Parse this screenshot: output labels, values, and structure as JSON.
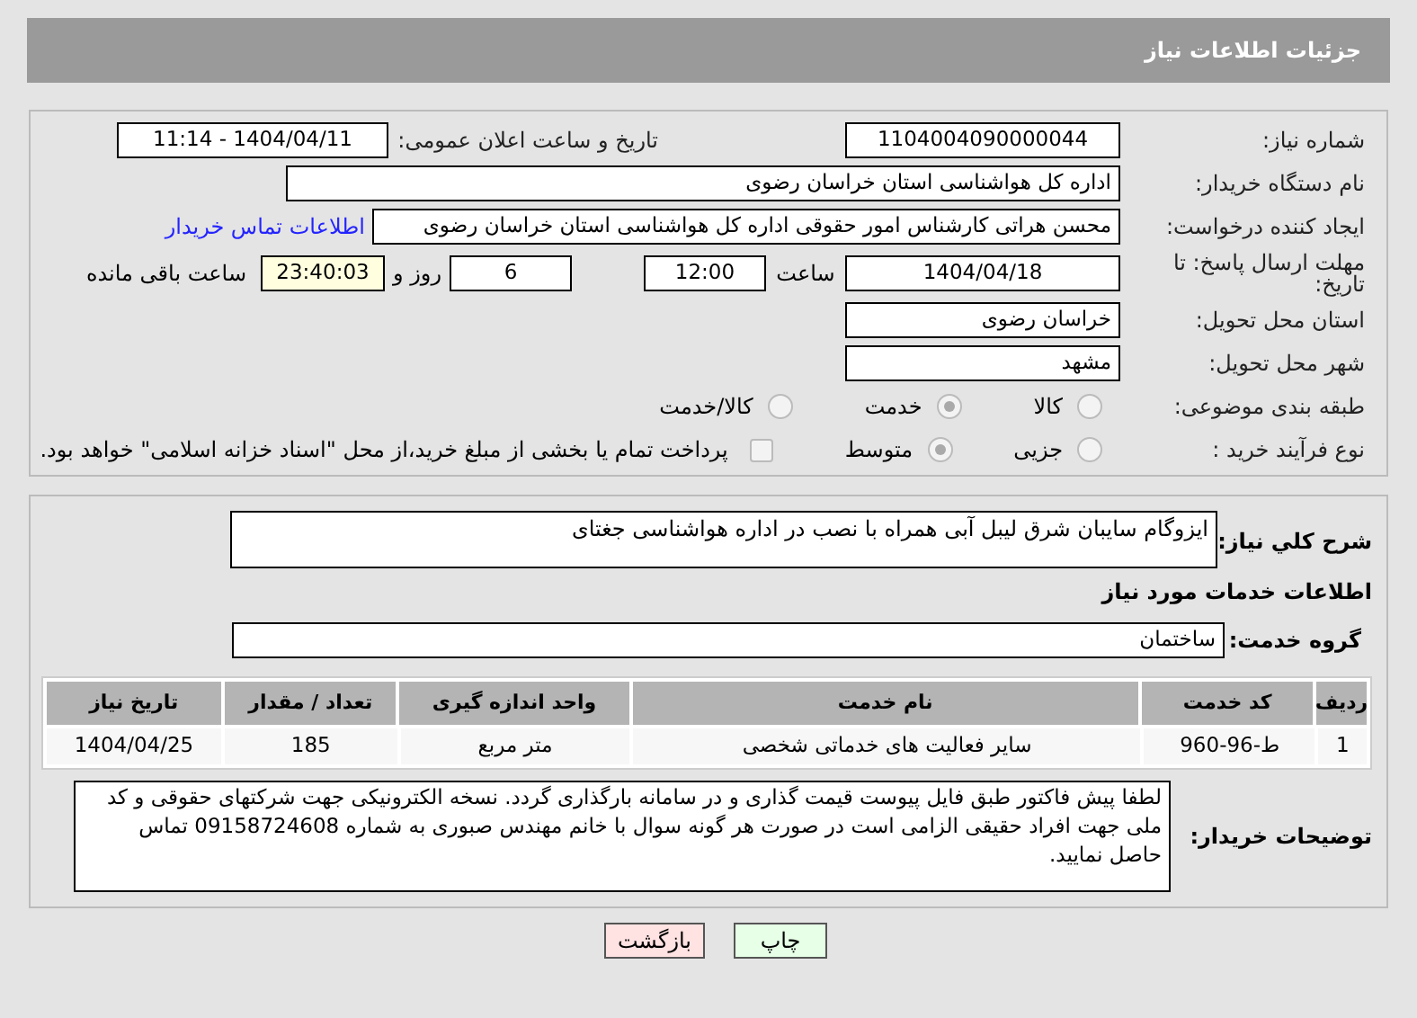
{
  "header": {
    "title": "جزئیات اطلاعات نیاز"
  },
  "need_number": {
    "label": "شماره نیاز:",
    "value": "1104004090000044"
  },
  "announce_date": {
    "label": "تاریخ و ساعت اعلان عمومی:",
    "value": "1404/04/11 - 11:14"
  },
  "buyer_org": {
    "label": "نام دستگاه خریدار:",
    "value": "اداره کل هواشناسی استان خراسان رضوی"
  },
  "requester": {
    "label": "ایجاد کننده درخواست:",
    "value": "محسن هراتی کارشناس امور حقوقی اداره کل هواشناسی استان خراسان رضوی",
    "link": "اطلاعات تماس خریدار"
  },
  "deadline": {
    "label": "مهلت ارسال پاسخ: تا تاریخ:",
    "date": "1404/04/18",
    "time_label": "ساعت",
    "time": "12:00",
    "days": "6",
    "days_label": "روز و",
    "remaining": "23:40:03",
    "remaining_label": "ساعت باقی مانده"
  },
  "delivery_province": {
    "label": "استان محل تحویل:",
    "value": "خراسان رضوی"
  },
  "delivery_city": {
    "label": "شهر محل تحویل:",
    "value": "مشهد"
  },
  "category": {
    "label": "طبقه بندی موضوعی:",
    "options": [
      {
        "label": "کالا",
        "selected": false
      },
      {
        "label": "خدمت",
        "selected": true
      },
      {
        "label": "کالا/خدمت",
        "selected": false
      }
    ]
  },
  "process": {
    "label": "نوع فرآیند خرید :",
    "options": [
      {
        "label": "جزیی",
        "selected": false
      },
      {
        "label": "متوسط",
        "selected": true
      }
    ],
    "payment": {
      "label": "پرداخت تمام یا بخشی از مبلغ خرید،از محل \"اسناد خزانه اسلامی\" خواهد بود.",
      "checked": false
    }
  },
  "description": {
    "label": "شرح کلي نياز:",
    "value": "ایزوگام سایبان شرق لیبل آبی همراه با نصب در اداره هواشناسی جغتای"
  },
  "services_heading": "اطلاعات خدمات مورد نیاز",
  "service_group": {
    "label": "گروه خدمت:",
    "value": "ساختمان"
  },
  "table": {
    "columns": [
      "ردیف",
      "کد خدمت",
      "نام خدمت",
      "واحد اندازه گیری",
      "تعداد / مقدار",
      "تاریخ نیاز"
    ],
    "rows": [
      [
        "1",
        "ط-96-960",
        "سایر فعالیت های خدماتی شخصی",
        "متر مربع",
        "185",
        "1404/04/25"
      ]
    ]
  },
  "buyer_notes": {
    "label": "توضیحات خریدار:",
    "value": "لطفا پیش فاکتور طبق فایل پیوست قیمت گذاری  و در سامانه بارگذاری گردد. نسخه الکترونیکی جهت شرکتهای حقوقی و کد ملی جهت افراد حقیقی الزامی است در صورت هر گونه سوال با خانم مهندس صبوری به شماره  09158724608 تماس حاصل نمایید."
  },
  "buttons": [
    {
      "label": "چاپ",
      "kind": "print"
    },
    {
      "label": "بازگشت",
      "kind": "back"
    }
  ]
}
